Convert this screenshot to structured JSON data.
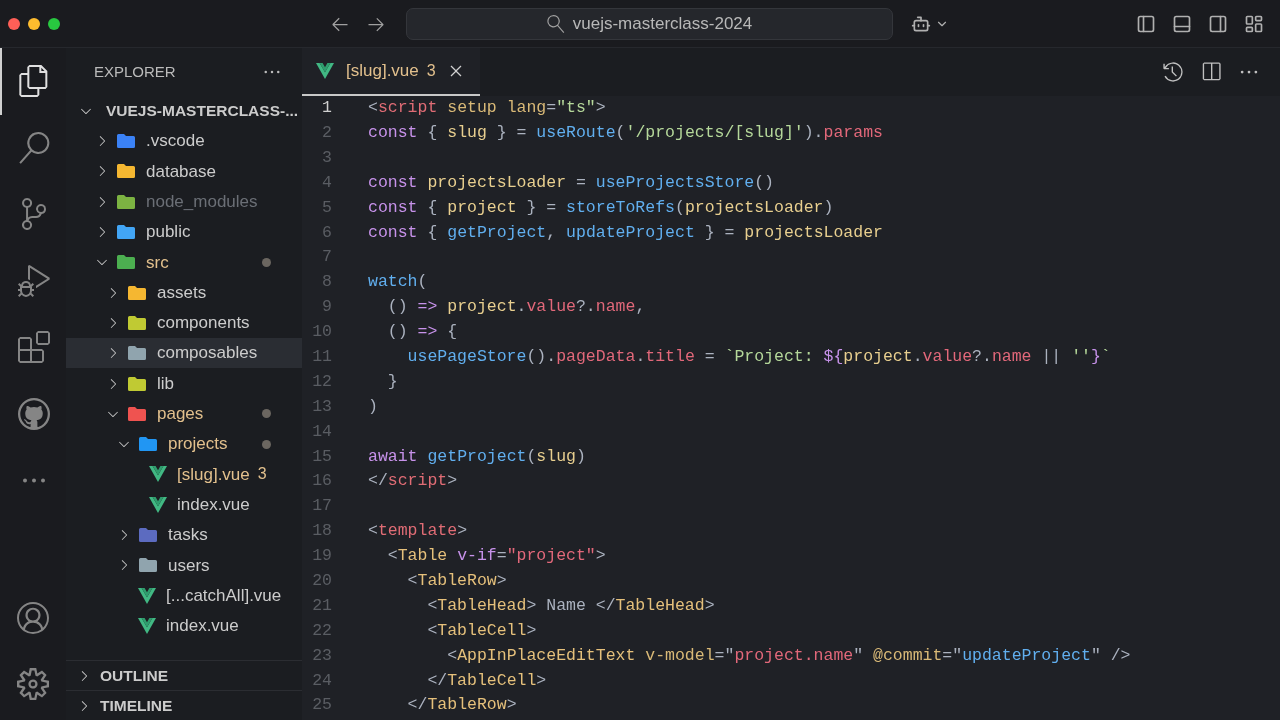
{
  "title_bar": {
    "search": "vuejs-masterclass-2024"
  },
  "activity_bar": [
    {
      "selected": true
    },
    {
      "selected": false
    },
    {
      "selected": false
    },
    {
      "selected": false
    },
    {
      "selected": false
    },
    {
      "selected": false
    },
    {
      "selected": false
    }
  ],
  "explorer": {
    "title": "EXPLORER",
    "root": {
      "label": "VUEJS-MASTERCLASS-...",
      "expanded": true
    },
    "tree": [
      {
        "label": ".vscode",
        "kind": "folder",
        "color": "#3b82f6",
        "expanded": false
      },
      {
        "label": "database",
        "kind": "folder",
        "color": "#f5b731",
        "expanded": false
      },
      {
        "label": "node_modules",
        "kind": "folder",
        "color": "#7cb342",
        "expanded": false,
        "ignored": true
      },
      {
        "label": "public",
        "kind": "folder",
        "color": "#42a5f5",
        "expanded": false
      },
      {
        "label": "src",
        "kind": "folder",
        "color": "#4caf50",
        "expanded": true,
        "modified": true,
        "children": [
          {
            "label": "assets",
            "kind": "folder",
            "color": "#f5b731",
            "expanded": false
          },
          {
            "label": "components",
            "kind": "folder",
            "color": "#c0ca33",
            "expanded": false
          },
          {
            "label": "composables",
            "kind": "folder",
            "color": "#90a4ae",
            "expanded": false,
            "selected": true
          },
          {
            "label": "lib",
            "kind": "folder",
            "color": "#c0ca33",
            "expanded": false
          },
          {
            "label": "pages",
            "kind": "folder",
            "color": "#ef5350",
            "expanded": true,
            "modified": true,
            "children": [
              {
                "label": "projects",
                "kind": "folder",
                "color": "#2196f3",
                "expanded": true,
                "modified": true,
                "children": [
                  {
                    "label": "[slug].vue",
                    "kind": "file",
                    "modified": true,
                    "badge": "3"
                  },
                  {
                    "label": "index.vue",
                    "kind": "file"
                  }
                ]
              },
              {
                "label": "tasks",
                "kind": "folder",
                "color": "#5c6bc0",
                "expanded": false
              },
              {
                "label": "users",
                "kind": "folder",
                "color": "#90a4ae",
                "expanded": false
              },
              {
                "label": "[...catchAll].vue",
                "kind": "file"
              },
              {
                "label": "index.vue",
                "kind": "file"
              }
            ]
          }
        ]
      }
    ],
    "sections": [
      {
        "label": "OUTLINE",
        "expanded": false
      },
      {
        "label": "TIMELINE",
        "expanded": false
      }
    ]
  },
  "tabs": [
    {
      "label": "[slug].vue",
      "badge": "3",
      "selected": true
    }
  ],
  "code": [
    {
      "number": "1",
      "tokens": [
        {
          "text": "<",
          "kind": "punct"
        },
        {
          "text": "script",
          "kind": "tag"
        },
        {
          "text": " setup lang",
          "kind": "attr"
        },
        {
          "text": "=",
          "kind": "punct"
        },
        {
          "text": "\"ts\"",
          "kind": "str"
        },
        {
          "text": ">",
          "kind": "punct"
        }
      ]
    },
    {
      "number": "2",
      "tokens": [
        {
          "text": "const",
          "kind": "kw"
        },
        {
          "text": " { ",
          "kind": "punct"
        },
        {
          "text": "slug",
          "kind": "var"
        },
        {
          "text": " } = ",
          "kind": "punct"
        },
        {
          "text": "useRoute",
          "kind": "fn"
        },
        {
          "text": "(",
          "kind": "punct"
        },
        {
          "text": "'/projects/[slug]'",
          "kind": "str"
        },
        {
          "text": ").",
          "kind": "punct"
        },
        {
          "text": "params",
          "kind": "prop"
        }
      ]
    },
    {
      "number": "3"
    },
    {
      "number": "4",
      "tokens": [
        {
          "text": "const ",
          "kind": "kw"
        },
        {
          "text": "projectsLoader",
          "kind": "var"
        },
        {
          "text": " = ",
          "kind": "punct"
        },
        {
          "text": "useProjectsStore",
          "kind": "fn"
        },
        {
          "text": "()",
          "kind": "punct"
        }
      ]
    },
    {
      "number": "5",
      "tokens": [
        {
          "text": "const",
          "kind": "kw"
        },
        {
          "text": " { ",
          "kind": "punct"
        },
        {
          "text": "project",
          "kind": "var"
        },
        {
          "text": " } = ",
          "kind": "punct"
        },
        {
          "text": "storeToRefs",
          "kind": "fn"
        },
        {
          "text": "(",
          "kind": "punct"
        },
        {
          "text": "projectsLoader",
          "kind": "var"
        },
        {
          "text": ")",
          "kind": "punct"
        }
      ]
    },
    {
      "number": "6",
      "tokens": [
        {
          "text": "const",
          "kind": "kw"
        },
        {
          "text": " { ",
          "kind": "punct"
        },
        {
          "text": "getProject",
          "kind": "fn"
        },
        {
          "text": ", ",
          "kind": "punct"
        },
        {
          "text": "updateProject",
          "kind": "fn"
        },
        {
          "text": " } = ",
          "kind": "punct"
        },
        {
          "text": "projectsLoader",
          "kind": "var"
        }
      ]
    },
    {
      "number": "7"
    },
    {
      "number": "8",
      "tokens": [
        {
          "text": "watch",
          "kind": "fn"
        },
        {
          "text": "(",
          "kind": "punct"
        }
      ]
    },
    {
      "number": "9",
      "tokens": [
        {
          "text": "  () ",
          "kind": "punct"
        },
        {
          "text": "=> ",
          "kind": "kw"
        },
        {
          "text": "project",
          "kind": "var"
        },
        {
          "text": ".",
          "kind": "punct"
        },
        {
          "text": "value",
          "kind": "prop"
        },
        {
          "text": "?.",
          "kind": "punct"
        },
        {
          "text": "name",
          "kind": "prop"
        },
        {
          "text": ",",
          "kind": "punct"
        }
      ]
    },
    {
      "number": "10",
      "tokens": [
        {
          "text": "  () ",
          "kind": "punct"
        },
        {
          "text": "=>",
          "kind": "kw"
        },
        {
          "text": " {",
          "kind": "punct"
        }
      ]
    },
    {
      "number": "11",
      "tokens": [
        {
          "text": "    usePageStore",
          "kind": "fn"
        },
        {
          "text": "().",
          "kind": "punct"
        },
        {
          "text": "pageData",
          "kind": "prop"
        },
        {
          "text": ".",
          "kind": "punct"
        },
        {
          "text": "title",
          "kind": "prop"
        },
        {
          "text": " = ",
          "kind": "punct"
        },
        {
          "text": "`Project: ",
          "kind": "str"
        },
        {
          "text": "${",
          "kind": "kw"
        },
        {
          "text": "project",
          "kind": "var"
        },
        {
          "text": ".",
          "kind": "punct"
        },
        {
          "text": "value",
          "kind": "prop"
        },
        {
          "text": "?.",
          "kind": "punct"
        },
        {
          "text": "name",
          "kind": "prop"
        },
        {
          "text": " || ",
          "kind": "punct"
        },
        {
          "text": "''",
          "kind": "str"
        },
        {
          "text": "}",
          "kind": "kw"
        },
        {
          "text": "`",
          "kind": "str"
        }
      ]
    },
    {
      "number": "12",
      "tokens": [
        {
          "text": "  }",
          "kind": "punct"
        }
      ]
    },
    {
      "number": "13",
      "tokens": [
        {
          "text": ")",
          "kind": "punct"
        }
      ]
    },
    {
      "number": "14"
    },
    {
      "number": "15",
      "tokens": [
        {
          "text": "await ",
          "kind": "kw"
        },
        {
          "text": "getProject",
          "kind": "fn"
        },
        {
          "text": "(",
          "kind": "punct"
        },
        {
          "text": "slug",
          "kind": "var"
        },
        {
          "text": ")",
          "kind": "punct"
        }
      ]
    },
    {
      "number": "16",
      "tokens": [
        {
          "text": "</",
          "kind": "punct"
        },
        {
          "text": "script",
          "kind": "tag"
        },
        {
          "text": ">",
          "kind": "punct"
        }
      ]
    },
    {
      "number": "17"
    },
    {
      "number": "18",
      "tokens": [
        {
          "text": "<",
          "kind": "punct"
        },
        {
          "text": "template",
          "kind": "tag"
        },
        {
          "text": ">",
          "kind": "punct"
        }
      ]
    },
    {
      "number": "19",
      "tokens": [
        {
          "text": "  <",
          "kind": "punct"
        },
        {
          "text": "Table",
          "kind": "comp"
        },
        {
          "text": " v-if",
          "kind": "kw"
        },
        {
          "text": "=",
          "kind": "punct"
        },
        {
          "text": "\"project\"",
          "kind": "prop"
        },
        {
          "text": ">",
          "kind": "punct"
        }
      ]
    },
    {
      "number": "20",
      "tokens": [
        {
          "text": "    <",
          "kind": "punct"
        },
        {
          "text": "TableRow",
          "kind": "comp"
        },
        {
          "text": ">",
          "kind": "punct"
        }
      ]
    },
    {
      "number": "21",
      "tokens": [
        {
          "text": "      <",
          "kind": "punct"
        },
        {
          "text": "TableHead",
          "kind": "comp"
        },
        {
          "text": "> Name </",
          "kind": "punct"
        },
        {
          "text": "TableHead",
          "kind": "comp"
        },
        {
          "text": ">",
          "kind": "punct"
        }
      ]
    },
    {
      "number": "22",
      "tokens": [
        {
          "text": "      <",
          "kind": "punct"
        },
        {
          "text": "TableCell",
          "kind": "comp"
        },
        {
          "text": ">",
          "kind": "punct"
        }
      ]
    },
    {
      "number": "23",
      "tokens": [
        {
          "text": "        <",
          "kind": "punct"
        },
        {
          "text": "AppInPlaceEditText",
          "kind": "comp"
        },
        {
          "text": " v-model",
          "kind": "attr"
        },
        {
          "text": "=\"",
          "kind": "punct"
        },
        {
          "text": "project.name",
          "kind": "prop"
        },
        {
          "text": "\" ",
          "kind": "punct"
        },
        {
          "text": "@commit",
          "kind": "attr"
        },
        {
          "text": "=\"",
          "kind": "punct"
        },
        {
          "text": "updateProject",
          "kind": "fn"
        },
        {
          "text": "\" />",
          "kind": "punct"
        }
      ]
    },
    {
      "number": "24",
      "tokens": [
        {
          "text": "      </",
          "kind": "punct"
        },
        {
          "text": "TableCell",
          "kind": "comp"
        },
        {
          "text": ">",
          "kind": "punct"
        }
      ]
    },
    {
      "number": "25",
      "tokens": [
        {
          "text": "    </",
          "kind": "punct"
        },
        {
          "text": "TableRow",
          "kind": "comp"
        },
        {
          "text": ">",
          "kind": "punct"
        }
      ]
    }
  ]
}
